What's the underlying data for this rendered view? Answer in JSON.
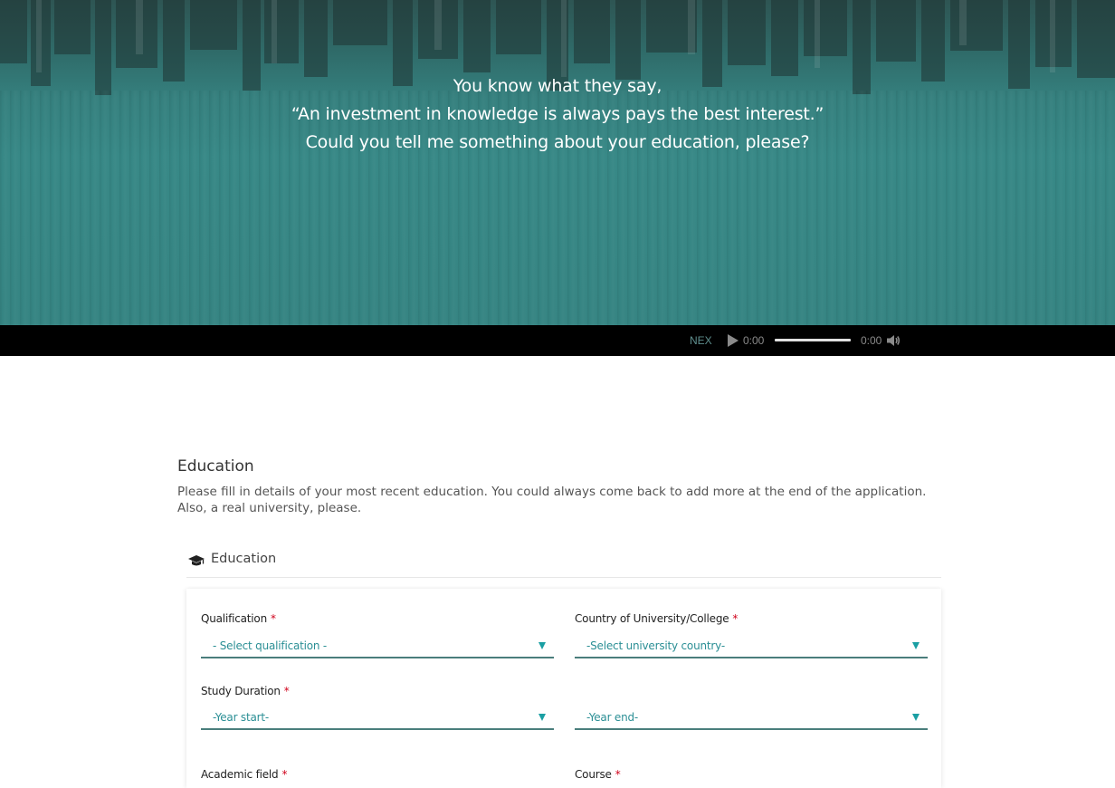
{
  "hero": {
    "quote_lines": [
      "You know what they say,",
      "“An investment in knowledge is always pays the best interest.”",
      "Could you tell me something about your education, please?"
    ]
  },
  "player": {
    "label": "NEX",
    "current_time": "0:00",
    "duration": "0:00",
    "progress": 0
  },
  "section": {
    "title": "Education",
    "description": "Please fill in details of your most recent education. You could always come back to add more at the end of the application. Also, a real university, please."
  },
  "card": {
    "title": "Education",
    "icon": "graduation-cap-icon"
  },
  "form": {
    "qualification": {
      "label": "Qualification",
      "required": "*",
      "value": "- Select qualification -"
    },
    "country": {
      "label": "Country of University/College",
      "required": "*",
      "value": "-Select university country-"
    },
    "study_duration": {
      "label": "Study Duration",
      "required": "*",
      "start_value": "-Year start-",
      "end_value": "-Year end-"
    },
    "academic_field": {
      "label": "Academic field",
      "required": "*"
    },
    "course": {
      "label": "Course",
      "required": "*"
    }
  },
  "colors": {
    "hero_teal": "#378886",
    "accent": "#2b8f95",
    "required": "#d0021b",
    "player_bg": "#000000"
  }
}
